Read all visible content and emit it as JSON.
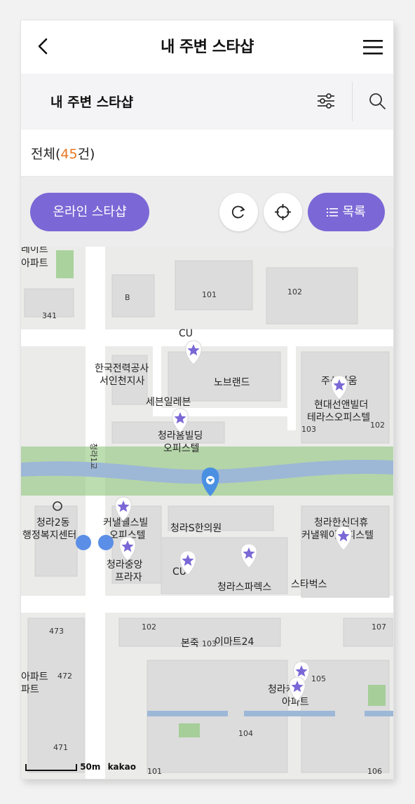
{
  "header": {
    "title": "내 주변 스타샵"
  },
  "subheader": {
    "title": "내 주변 스타샵"
  },
  "count": {
    "prefix": "전체(",
    "value": "45",
    "suffix": "건)"
  },
  "toolbar": {
    "online_label": "온라인 스타샵",
    "list_label": "목록"
  },
  "map": {
    "labels": {
      "apt_top": "아파트",
      "apt_top2": "레이트",
      "b341": "341",
      "b101": "101",
      "b102": "102",
      "bB": "B",
      "cu": "CU",
      "kepco": "한국전력공사",
      "kepco2": "서인천지사",
      "nobrand": "노브랜드",
      "seven": "세븐일레븐",
      "cheongra_bldg": "청라홈빌딩",
      "officetel": "오피스텔",
      "hyundai1": "주상가움",
      "hyundai2": "현대선앤빌더",
      "hyundai3": "테라스오피스텔",
      "b103": "103",
      "b102b": "102",
      "bridge": "청라1교",
      "dong1": "청라2동",
      "dong2": "행정복지센터",
      "canal1": "커낼웰스빌",
      "canal2": "오피스텔",
      "clinic": "청라S한의원",
      "hanshin1": "청라한신더휴",
      "hanshin2": "커낼웨이오피스텔",
      "central1": "청라중앙",
      "central2": "프라자",
      "cu2": "CU",
      "parks": "청라스파렉스",
      "starbucks": "스타벅스",
      "b473": "473",
      "b102c": "102",
      "bonjuk": "본죽",
      "b103b": "103",
      "emart": "이마트24",
      "b107": "107",
      "apt_low": "아파트",
      "apt_low2": "파트",
      "b472": "472",
      "cheongra_cap": "청라캐슬",
      "b105": "105",
      "apartment_short": "아파트",
      "b104": "104",
      "b471": "471",
      "b101b": "101",
      "b106": "106"
    },
    "scale": {
      "distance": "50m",
      "brand": "kakao"
    }
  },
  "colors": {
    "accent": "#7b68d6",
    "count": "#e87722",
    "pin": "#4a90e2",
    "water": "#9db7d6",
    "park": "#8fc77c"
  }
}
